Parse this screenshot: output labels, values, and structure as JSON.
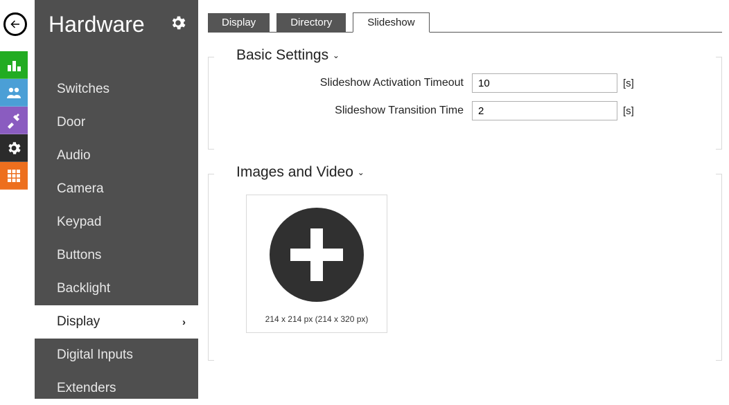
{
  "header": {
    "title": "Hardware"
  },
  "sidebar": {
    "items": [
      {
        "label": "Switches",
        "active": false
      },
      {
        "label": "Door",
        "active": false
      },
      {
        "label": "Audio",
        "active": false
      },
      {
        "label": "Camera",
        "active": false
      },
      {
        "label": "Keypad",
        "active": false
      },
      {
        "label": "Buttons",
        "active": false
      },
      {
        "label": "Backlight",
        "active": false
      },
      {
        "label": "Display",
        "active": true
      },
      {
        "label": "Digital Inputs",
        "active": false
      },
      {
        "label": "Extenders",
        "active": false
      }
    ]
  },
  "tabs": [
    {
      "label": "Display",
      "active": false
    },
    {
      "label": "Directory",
      "active": false
    },
    {
      "label": "Slideshow",
      "active": true
    }
  ],
  "sections": {
    "basic": {
      "title": "Basic Settings",
      "rows": [
        {
          "label": "Slideshow Activation Timeout",
          "value": "10",
          "unit": "[s]"
        },
        {
          "label": "Slideshow Transition Time",
          "value": "2",
          "unit": "[s]"
        }
      ]
    },
    "media": {
      "title": "Images and Video",
      "placeholder_caption": "214 x 214 px (214 x 320 px)"
    }
  }
}
